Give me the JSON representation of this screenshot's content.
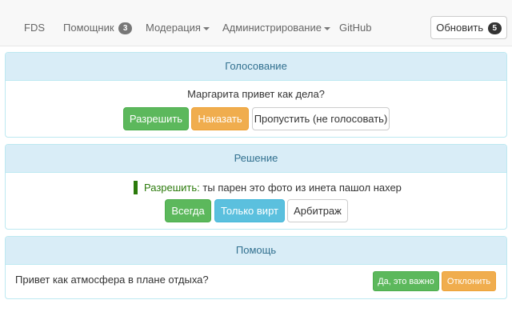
{
  "navbar": {
    "brand": "FDS",
    "helper": {
      "label": "Помощник",
      "badge": "3"
    },
    "moderation": "Модерация",
    "administration": "Администрирование",
    "github": "GitHub",
    "refresh": {
      "label": "Обновить",
      "badge": "5"
    }
  },
  "voting": {
    "title": "Голосование",
    "message": "Маргарита привет как дела?",
    "allow": "Разрешить",
    "punish": "Наказать",
    "skip": "Пропустить (не голосовать)"
  },
  "decision": {
    "title": "Решение",
    "verdict": "Разрешить:",
    "text": "ты парен это фото из инета пашол нахер",
    "always": "Всегда",
    "virt_only": "Только вирт",
    "arbitration": "Арбитраж"
  },
  "help": {
    "title": "Помощь",
    "message": "Привет как атмосфера в плане отдыха?",
    "important": "Да, это важно",
    "reject": "Отклонить"
  },
  "colors": {
    "success": "#5cb85c",
    "warning": "#f0ad4e",
    "info": "#5bc0de",
    "panel_heading": "#d9edf7"
  }
}
